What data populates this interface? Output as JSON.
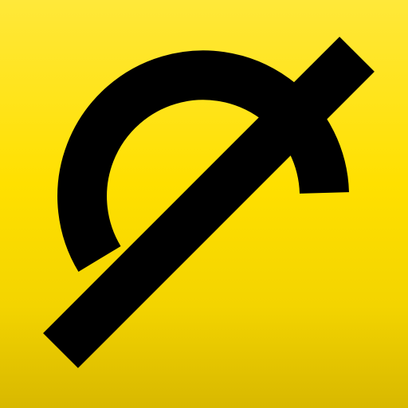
{
  "app_icon": {
    "glyph": "empty-set-symbol",
    "colors": {
      "background_top": "#ffe83a",
      "background_mid": "#ffe000",
      "background_bottom": "#d8b800",
      "glyph": "#000000"
    }
  }
}
